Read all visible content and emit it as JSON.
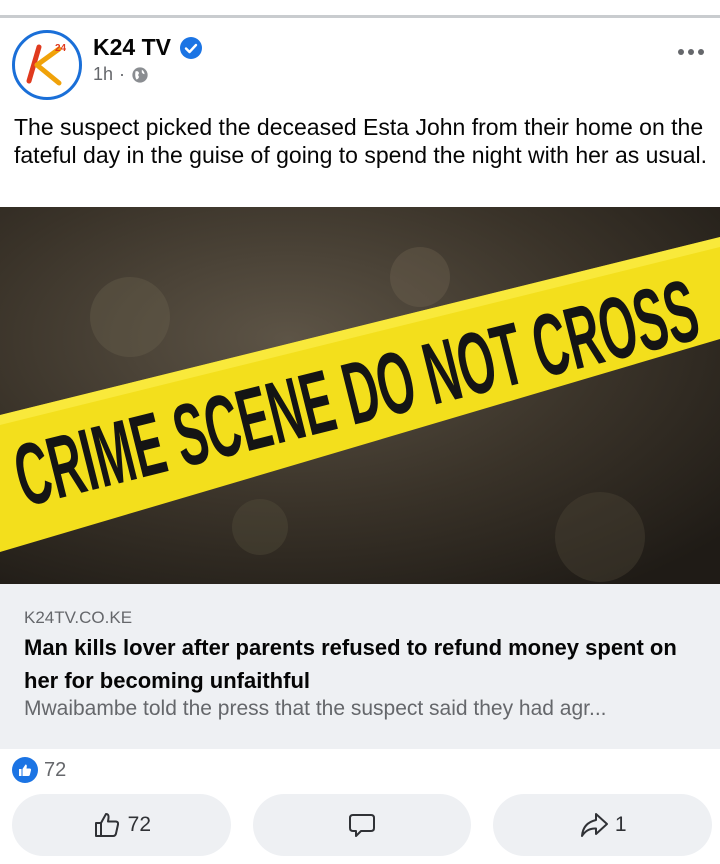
{
  "post": {
    "page_name": "K24 TV",
    "time": "1h",
    "separator": "·",
    "text": "The suspect picked the deceased Esta John from their home on the fateful day in the guise of going to spend the night with her as usual."
  },
  "photo": {
    "tape_text": "CRIME SCENE DO NOT CROSS"
  },
  "link_card": {
    "domain": "K24TV.CO.KE",
    "headline": "Man kills lover after parents refused to refund money spent on her for becoming unfaithful",
    "description": "Mwaibambe told the press that the suspect said they had agr..."
  },
  "reactions": {
    "count": "72"
  },
  "actions": {
    "like_count": "72",
    "share_count": "1"
  },
  "logo": {
    "text": "24"
  },
  "colors": {
    "brand_blue": "#1b74e4",
    "tape_yellow": "#f3df1c",
    "card_bg": "#eef0f3"
  },
  "icons": [
    "verified-badge-icon",
    "globe-icon",
    "more-options-icon",
    "like-reaction-icon",
    "thumbs-up-icon",
    "comment-icon",
    "share-icon"
  ]
}
